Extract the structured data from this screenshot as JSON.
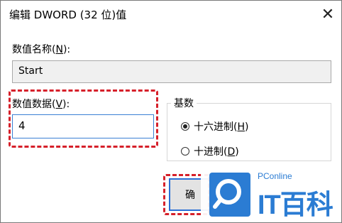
{
  "window": {
    "title": "编辑 DWORD (32 位)值",
    "close_symbol": "✕"
  },
  "value_name": {
    "label_prefix": "数值名称(",
    "label_key": "N",
    "label_suffix": "):",
    "value": "Start"
  },
  "value_data": {
    "label_prefix": "数值数据(",
    "label_key": "V",
    "label_suffix": "):",
    "value": "4"
  },
  "base": {
    "title": "基数",
    "options": [
      {
        "label_prefix": "十六进制(",
        "key": "H",
        "label_suffix": ")",
        "checked": true
      },
      {
        "label_prefix": "十进制(",
        "key": "D",
        "label_suffix": ")",
        "checked": false
      }
    ]
  },
  "buttons": {
    "ok_label": "确"
  },
  "watermark": {
    "small_text": "PConline",
    "big_text": "IT百科"
  },
  "colors": {
    "highlight_dash": "#d6202a",
    "focus_border": "#3b7fd4",
    "brand_blue": "#2b7cd3"
  }
}
